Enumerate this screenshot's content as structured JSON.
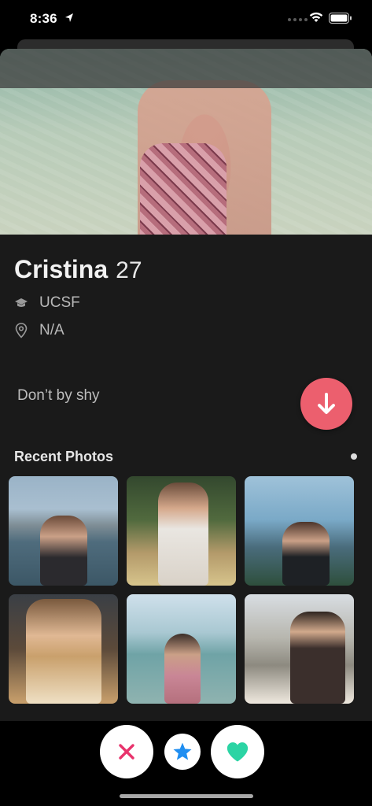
{
  "status_bar": {
    "time": "8:36",
    "icons": [
      "location-arrow-icon",
      "signal-icon",
      "wifi-icon",
      "battery-icon"
    ]
  },
  "profile": {
    "name": "Cristina",
    "age": "27",
    "school": "UCSF",
    "location": "N/A",
    "bio": "Don’t by shy",
    "school_icon": "graduation-cap-icon",
    "location_icon": "map-pin-icon"
  },
  "recent_photos": {
    "title": "Recent Photos",
    "count": 6
  },
  "actions": {
    "collapse_icon": "arrow-down-icon",
    "nope_icon": "x-icon",
    "super_like_icon": "star-icon",
    "like_icon": "heart-icon"
  },
  "colors": {
    "accent_red": "#ec5f6e",
    "nope_pink": "#e8336c",
    "star_blue": "#1f8ef1",
    "like_green": "#2bd4a4",
    "background": "#1a1a1a"
  }
}
